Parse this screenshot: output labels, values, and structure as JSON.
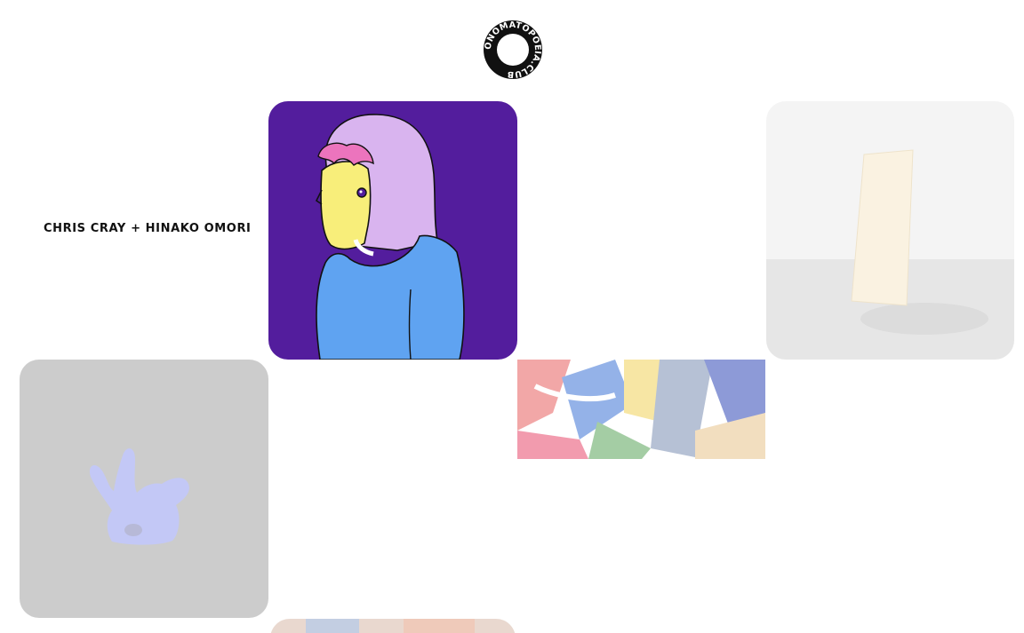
{
  "logo": {
    "text": "ONOMATOPOEIA.CLUB",
    "icon": "circular-text-logo"
  },
  "artist": {
    "label": "CHRIS CRAY + HINAKO OMORI"
  },
  "tiles": [
    {
      "name": "portrait-illustration",
      "icon": "woman-portrait-illustration"
    },
    {
      "name": "faded-photo",
      "icon": "leaning-board-photo"
    },
    {
      "name": "squiggle-illustration",
      "icon": "blue-coral-shape"
    },
    {
      "name": "fabric-artwork",
      "icon": "colorful-fabric"
    },
    {
      "name": "bottom-artwork",
      "icon": "partial-artwork"
    }
  ],
  "colors": {
    "background": "#ffffff",
    "text": "#111111",
    "portrait_bg": "#531d9d",
    "hair": "#d9b4ef",
    "hair_fringe": "#ec74bd",
    "skin": "#f8ee7a",
    "shirt": "#5fa3f1",
    "squiggle_bg": "#cccccc",
    "squiggle_shape": "#c3c8f6"
  }
}
